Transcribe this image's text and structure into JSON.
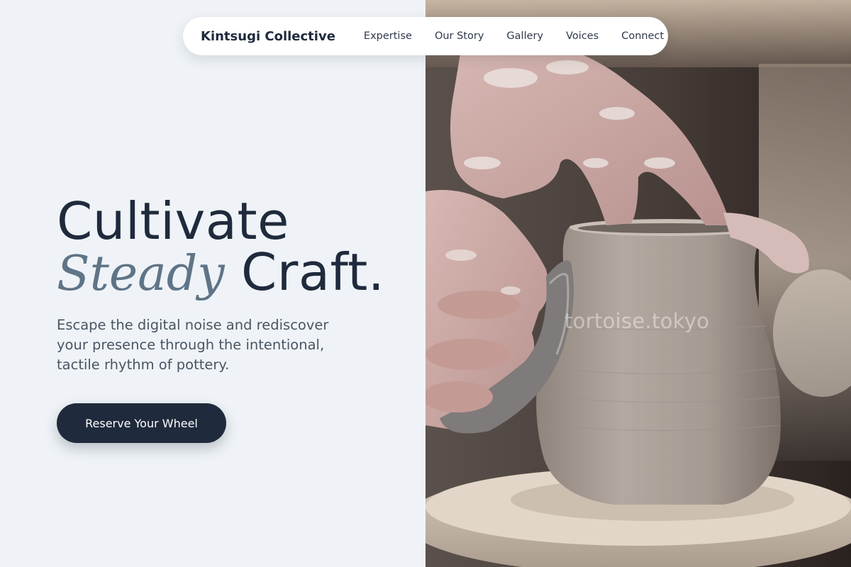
{
  "nav": {
    "brand": "Kintsugi Collective",
    "links": [
      "Expertise",
      "Our Story",
      "Gallery",
      "Voices",
      "Connect"
    ]
  },
  "hero": {
    "headline_line1": "Cultivate",
    "headline_accent": "Steady",
    "headline_rest": "Craft.",
    "lede": "Escape the digital noise and rediscover your presence through the intentional, tactile rhythm of pottery.",
    "cta_label": "Reserve Your Wheel"
  },
  "photo": {
    "watermark": "tortoise.tokyo",
    "subject": "hands shaping clay pot on pottery wheel"
  },
  "colors": {
    "background": "#eff3f7",
    "ink": "#1f2a3c",
    "accent": "#5f7486",
    "body_text": "#4a5563",
    "button": "#1f2a3c",
    "button_text": "#ffffff"
  }
}
